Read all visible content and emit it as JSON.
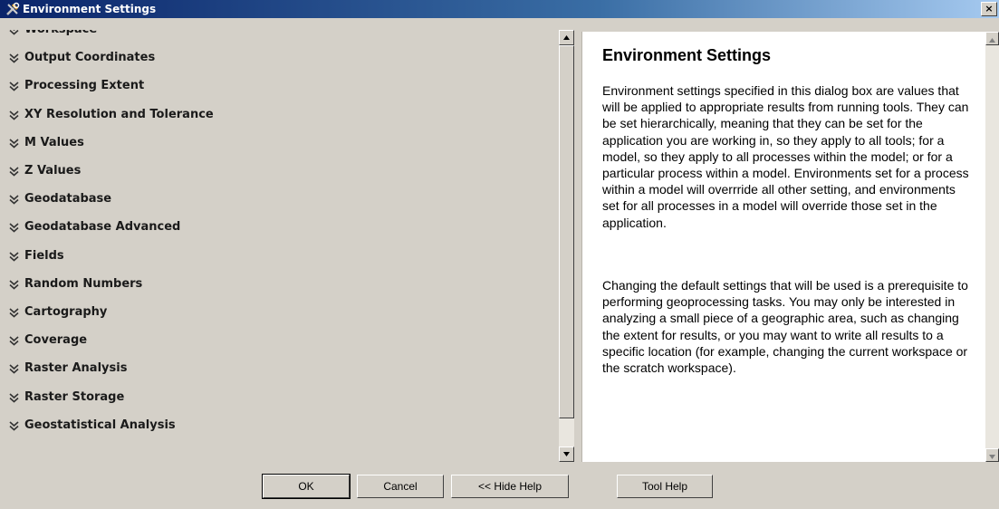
{
  "window": {
    "title": "Environment Settings",
    "close_label": "×"
  },
  "sections": [
    "Workspace",
    "Output Coordinates",
    "Processing Extent",
    "XY Resolution and Tolerance",
    "M Values",
    "Z Values",
    "Geodatabase",
    "Geodatabase Advanced",
    "Fields",
    "Random Numbers",
    "Cartography",
    "Coverage",
    "Raster Analysis",
    "Raster Storage",
    "Geostatistical Analysis"
  ],
  "help": {
    "title": "Environment Settings",
    "paragraphs": [
      "Environment settings specified in this dialog box are values that will be applied to appropriate results from running tools. They can be set hierarchically, meaning that they can be set for the application you are working in, so they apply to all tools; for a model, so they apply to all processes within the model; or for a particular process within a model. Environments set for a process within a model will overrride all other setting, and environments set for all processes in a model will override those set in the application.",
      "Changing the default settings that will be used is a prerequisite to performing geoprocessing tasks. You may only be interested in analyzing a small piece of a geographic area, such as changing the extent for results, or you may want to write all results to a specific location (for example, changing the current workspace or the scratch workspace)."
    ]
  },
  "buttons": {
    "ok": "OK",
    "cancel": "Cancel",
    "hide_help": "<< Hide Help",
    "tool_help": "Tool Help"
  },
  "colors": {
    "title_bar": "#0a246a",
    "dialog_face": "#d4d0c8",
    "help_background": "#ffffff"
  }
}
